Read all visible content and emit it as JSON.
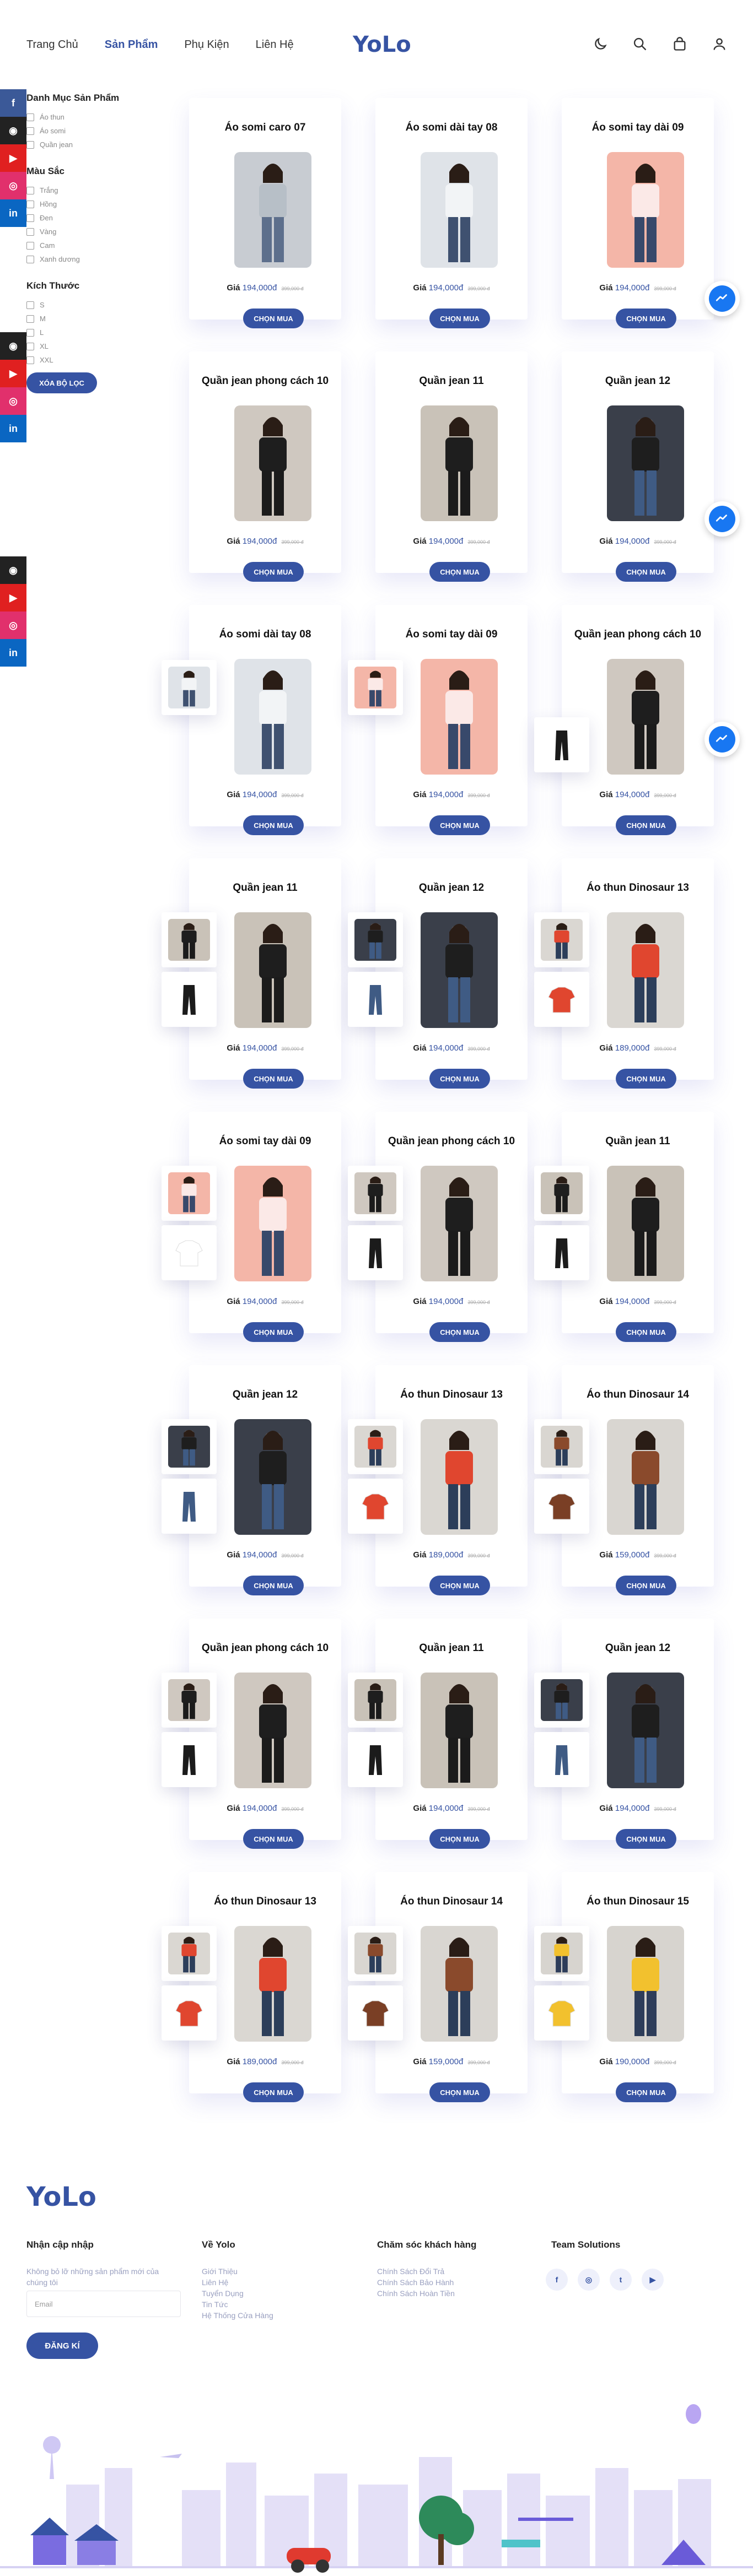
{
  "nav": {
    "links": [
      "Trang Chủ",
      "Sản Phẩm",
      "Phụ Kiện",
      "Liên Hệ"
    ],
    "logo": "YoLo",
    "icons": [
      "moon-icon",
      "search-icon",
      "bag-icon",
      "user-icon"
    ]
  },
  "social": [
    "facebook-icon",
    "github-icon",
    "youtube-icon",
    "instagram-icon",
    "linkedin-icon"
  ],
  "filter": {
    "category_title": "Danh Mục Sản Phẩm",
    "categories": [
      "Áo thun",
      "Áo somi",
      "Quần jean"
    ],
    "color_title": "Màu Sắc",
    "colors": [
      "Trắng",
      "Hồng",
      "Đen",
      "Vàng",
      "Cam",
      "Xanh dương"
    ],
    "size_title": "Kích Thước",
    "sizes": [
      "S",
      "M",
      "L",
      "XL",
      "XXL"
    ],
    "clear_label": "XÓA BỘ LỌC"
  },
  "price_label": "Giá",
  "buy_label": "CHỌN MUA",
  "products": [
    {
      "name": "Áo somi caro 07",
      "price": "194,000đ",
      "old": "399,000 đ",
      "img": "check"
    },
    {
      "name": "Áo somi dài tay 08",
      "price": "194,000đ",
      "old": "399,000 đ",
      "img": "white"
    },
    {
      "name": "Áo somi tay dài 09",
      "price": "194,000đ",
      "old": "399,000 đ",
      "img": "pink"
    },
    {
      "name": "Quần jean phong cách 10",
      "price": "194,000đ",
      "old": "399,000 đ",
      "img": "black"
    },
    {
      "name": "Quần jean 11",
      "price": "194,000đ",
      "old": "399,000 đ",
      "img": "black2"
    },
    {
      "name": "Quần jean 12",
      "price": "194,000đ",
      "old": "399,000 đ",
      "img": "blue"
    },
    {
      "name": "Áo somi dài tay 08",
      "price": "194,000đ",
      "old": "399,000 đ",
      "img": "white"
    },
    {
      "name": "Áo somi tay dài 09",
      "price": "194,000đ",
      "old": "399,000 đ",
      "img": "pink"
    },
    {
      "name": "Quần jean phong cách 10",
      "price": "194,000đ",
      "old": "399,000 đ",
      "img": "black"
    },
    {
      "name": "Quần jean 11",
      "price": "194,000đ",
      "old": "399,000 đ",
      "img": "black2"
    },
    {
      "name": "Quần jean 12",
      "price": "194,000đ",
      "old": "399,000 đ",
      "img": "blue"
    },
    {
      "name": "Áo thun Dinosaur 13",
      "price": "189,000đ",
      "old": "399,000 đ",
      "img": "red"
    },
    {
      "name": "Áo somi tay dài 09",
      "price": "194,000đ",
      "old": "399,000 đ",
      "img": "pink"
    },
    {
      "name": "Quần jean phong cách 10",
      "price": "194,000đ",
      "old": "399,000 đ",
      "img": "black"
    },
    {
      "name": "Quần jean 11",
      "price": "194,000đ",
      "old": "399,000 đ",
      "img": "black2"
    },
    {
      "name": "Quần jean 12",
      "price": "194,000đ",
      "old": "399,000 đ",
      "img": "blue"
    },
    {
      "name": "Áo thun Dinosaur 13",
      "price": "189,000đ",
      "old": "399,000 đ",
      "img": "red"
    },
    {
      "name": "Áo thun Dinosaur 14",
      "price": "159,000đ",
      "old": "399,000 đ",
      "img": "brown"
    },
    {
      "name": "Quần jean phong cách 10",
      "price": "194,000đ",
      "old": "399,000 đ",
      "img": "black"
    },
    {
      "name": "Quần jean 11",
      "price": "194,000đ",
      "old": "399,000 đ",
      "img": "black2"
    },
    {
      "name": "Quần jean 12",
      "price": "194,000đ",
      "old": "399,000 đ",
      "img": "blue"
    },
    {
      "name": "Áo thun Dinosaur 13",
      "price": "189,000đ",
      "old": "399,000 đ",
      "img": "red"
    },
    {
      "name": "Áo thun Dinosaur 14",
      "price": "159,000đ",
      "old": "399,000 đ",
      "img": "brown"
    },
    {
      "name": "Áo thun Dinosaur 15",
      "price": "190,000đ",
      "old": "399,000 đ",
      "img": "yellow"
    }
  ],
  "footer": {
    "logo": "YoLo",
    "newsletter_title": "Nhận cập nhập",
    "newsletter_text": "Không bỏ lỡ những sản phẩm mới của chúng tôi",
    "email_placeholder": "Email",
    "subscribe_label": "ĐĂNG KÍ",
    "about_title": "Về Yolo",
    "about_links": [
      "Giới Thiệu",
      "Liên Hệ",
      "Tuyển Dụng",
      "Tin Tức",
      "Hệ Thống Cửa Hàng"
    ],
    "care_title": "Chăm sóc khách hàng",
    "care_links": [
      "Chính Sách Đổi Trả",
      "Chính Sách Bảo Hành",
      "Chính Sách Hoàn Tiền"
    ],
    "team_title": "Team Solutions",
    "team_social": [
      "facebook-icon",
      "instagram-icon",
      "twitter-icon",
      "youtube-icon"
    ]
  },
  "colors": {
    "brand": "#3653a3",
    "messenger": "#1877f2"
  }
}
